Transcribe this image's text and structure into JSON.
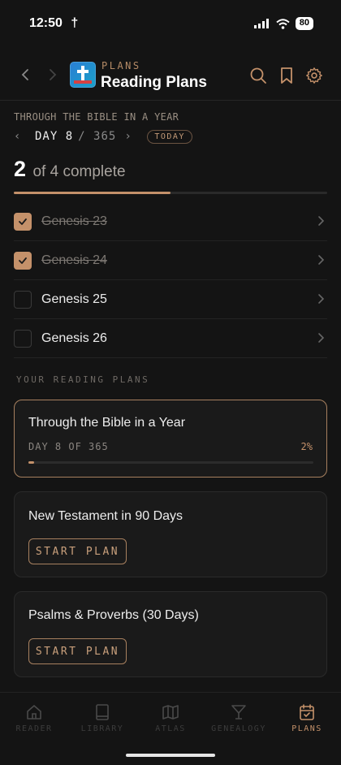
{
  "status_bar": {
    "time": "12:50",
    "battery": "80"
  },
  "header": {
    "kicker": "PLANS",
    "title": "Reading Plans"
  },
  "current_plan": {
    "name": "THROUGH THE BIBLE IN A YEAR",
    "day_label": "DAY 8",
    "day_total": "/ 365",
    "today_badge": "TODAY",
    "completed_count": "2",
    "complete_rest": "of 4 complete",
    "progress_fraction": 0.5
  },
  "chapters": [
    {
      "label": "Genesis 23",
      "done": true
    },
    {
      "label": "Genesis 24",
      "done": true
    },
    {
      "label": "Genesis 25",
      "done": false
    },
    {
      "label": "Genesis 26",
      "done": false
    }
  ],
  "section_label": "YOUR READING PLANS",
  "plans": [
    {
      "title": "Through the Bible in a Year",
      "day_text": "DAY 8 OF 365",
      "percent": "2%",
      "progress_fraction": 0.02
    },
    {
      "title": "New Testament in 90 Days",
      "button": "START PLAN"
    },
    {
      "title": "Psalms & Proverbs (30 Days)",
      "button": "START PLAN"
    }
  ],
  "tabs": [
    {
      "label": "READER",
      "icon": "home-icon"
    },
    {
      "label": "LIBRARY",
      "icon": "book-icon"
    },
    {
      "label": "ATLAS",
      "icon": "map-icon"
    },
    {
      "label": "GENEALOGY",
      "icon": "family-tree-icon"
    },
    {
      "label": "PLANS",
      "icon": "calendar-check-icon",
      "active": true
    }
  ],
  "colors": {
    "accent": "#c4916a",
    "background": "#141414",
    "card": "#1a1a1a"
  }
}
